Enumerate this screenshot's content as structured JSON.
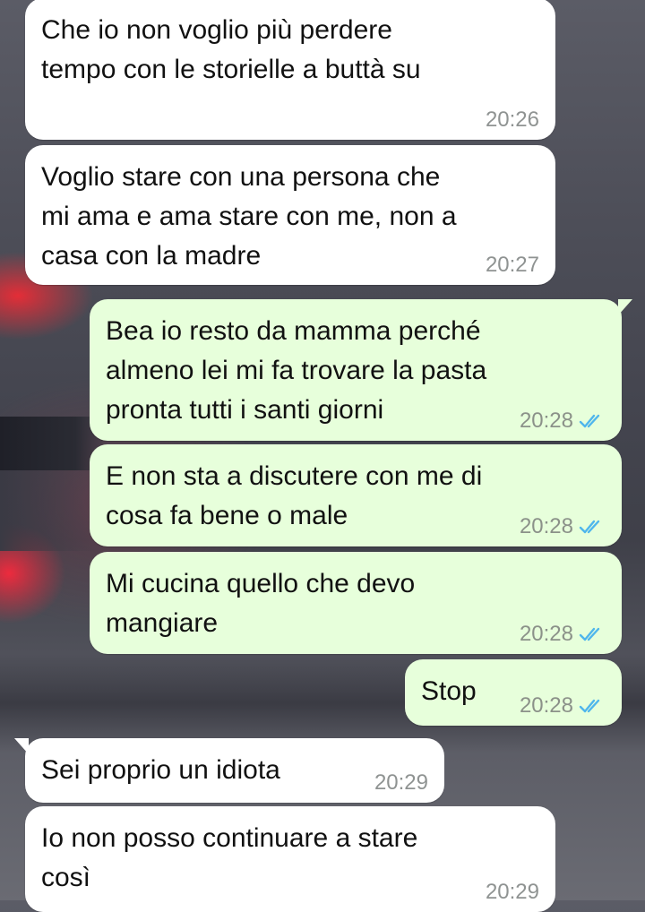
{
  "chat": {
    "colors": {
      "incoming_bubble": "#ffffff",
      "outgoing_bubble": "#e7ffdb",
      "read_ticks": "#4fb6ec",
      "time_text": "#8b9189"
    },
    "messages": [
      {
        "direction": "in",
        "text": "Che io non voglio più perdere\ntempo con le storielle a buttà su",
        "time": "20:26"
      },
      {
        "direction": "in",
        "text": "Voglio stare con una persona che\nmi ama e ama stare con me, non a\ncasa con la madre",
        "time": "20:27"
      },
      {
        "direction": "out",
        "text": "Bea io resto da mamma perché\nalmeno lei mi fa trovare la pasta\npronta tutti i santi giorni",
        "time": "20:28",
        "status": "read"
      },
      {
        "direction": "out",
        "text": "E non sta a discutere con me di\ncosa fa bene o male",
        "time": "20:28",
        "status": "read"
      },
      {
        "direction": "out",
        "text": "Mi cucina quello che devo\nmangiare",
        "time": "20:28",
        "status": "read"
      },
      {
        "direction": "out",
        "text": "Stop",
        "time": "20:28",
        "status": "read"
      },
      {
        "direction": "in",
        "text": "Sei proprio un idiota",
        "time": "20:29"
      },
      {
        "direction": "in",
        "text": "Io non posso continuare a stare\ncosì",
        "time": "20:29"
      }
    ]
  }
}
